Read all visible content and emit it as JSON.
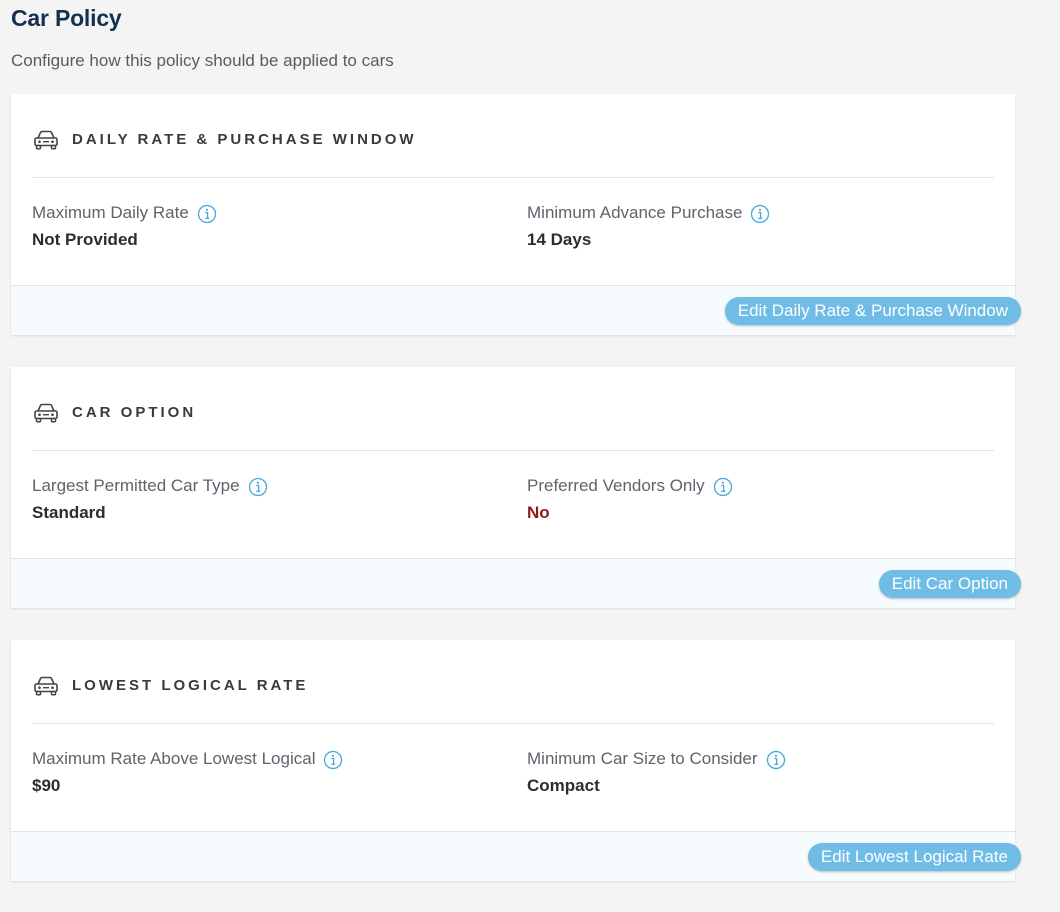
{
  "page": {
    "title": "Car Policy",
    "subtitle": "Configure how this policy should be applied to cars"
  },
  "colors": {
    "title": "#15304f",
    "button": "#6fbde6",
    "info_icon": "#4aa7d9",
    "negative_value": "#8e1b1b"
  },
  "sections": [
    {
      "icon": "car-icon",
      "title": "Daily Rate & Purchase Window",
      "fields": [
        {
          "label": "Maximum Daily Rate",
          "value": "Not Provided",
          "icon": "info-icon"
        },
        {
          "label": "Minimum Advance Purchase",
          "value": "14 Days",
          "icon": "info-icon"
        }
      ],
      "button_label": "Edit Daily Rate & Purchase Window"
    },
    {
      "icon": "car-icon",
      "title": "Car Option",
      "fields": [
        {
          "label": "Largest Permitted Car Type",
          "value": "Standard",
          "icon": "info-icon"
        },
        {
          "label": "Preferred Vendors Only",
          "value": "No",
          "icon": "info-icon"
        }
      ],
      "button_label": "Edit Car Option"
    },
    {
      "icon": "car-icon",
      "title": "Lowest Logical Rate",
      "fields": [
        {
          "label": "Maximum Rate Above Lowest Logical",
          "value": "$90",
          "icon": "info-icon"
        },
        {
          "label": "Minimum Car Size to Consider",
          "value": "Compact",
          "icon": "info-icon"
        }
      ],
      "button_label": "Edit Lowest Logical Rate"
    }
  ]
}
